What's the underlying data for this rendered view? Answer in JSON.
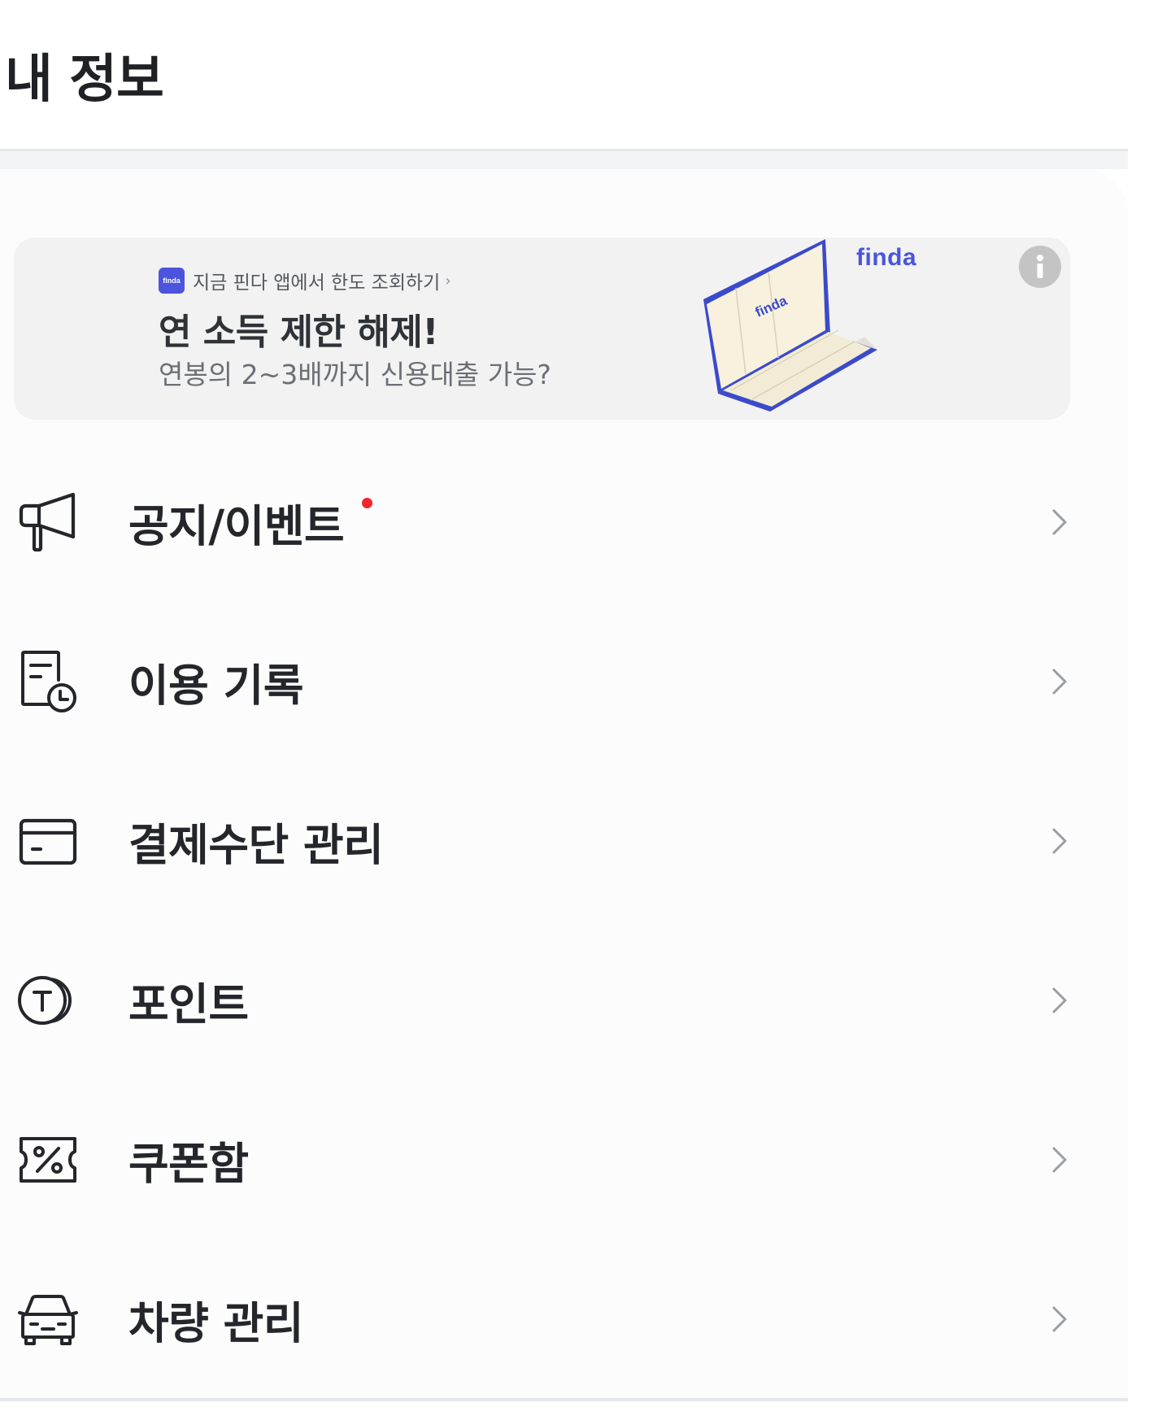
{
  "header": {
    "title": "내 정보"
  },
  "ad": {
    "badge_text": "finda",
    "top_text": "지금 핀다 앱에서 한도 조회하기",
    "top_chevron": "›",
    "headline": "연 소득 제한 해제!",
    "subtext": "연봉의 2~3배까지 신용대출 가능?",
    "brand": "finda",
    "book_text": "finda",
    "brand_color": "#4a54dd",
    "info_icon": "info-icon"
  },
  "menu": {
    "items": [
      {
        "label": "공지/이벤트",
        "icon": "megaphone-icon",
        "has_new_badge": true
      },
      {
        "label": "이용 기록",
        "icon": "usage-history-icon",
        "has_new_badge": false
      },
      {
        "label": "결제수단 관리",
        "icon": "credit-card-icon",
        "has_new_badge": false
      },
      {
        "label": "포인트",
        "icon": "point-coin-icon",
        "has_new_badge": false
      },
      {
        "label": "쿠폰함",
        "icon": "coupon-icon",
        "has_new_badge": false
      },
      {
        "label": "차량 관리",
        "icon": "car-icon",
        "has_new_badge": false
      }
    ]
  },
  "colors": {
    "text_primary": "#24262b",
    "badge_red": "#f2262c",
    "chevron": "#9a9da3"
  }
}
